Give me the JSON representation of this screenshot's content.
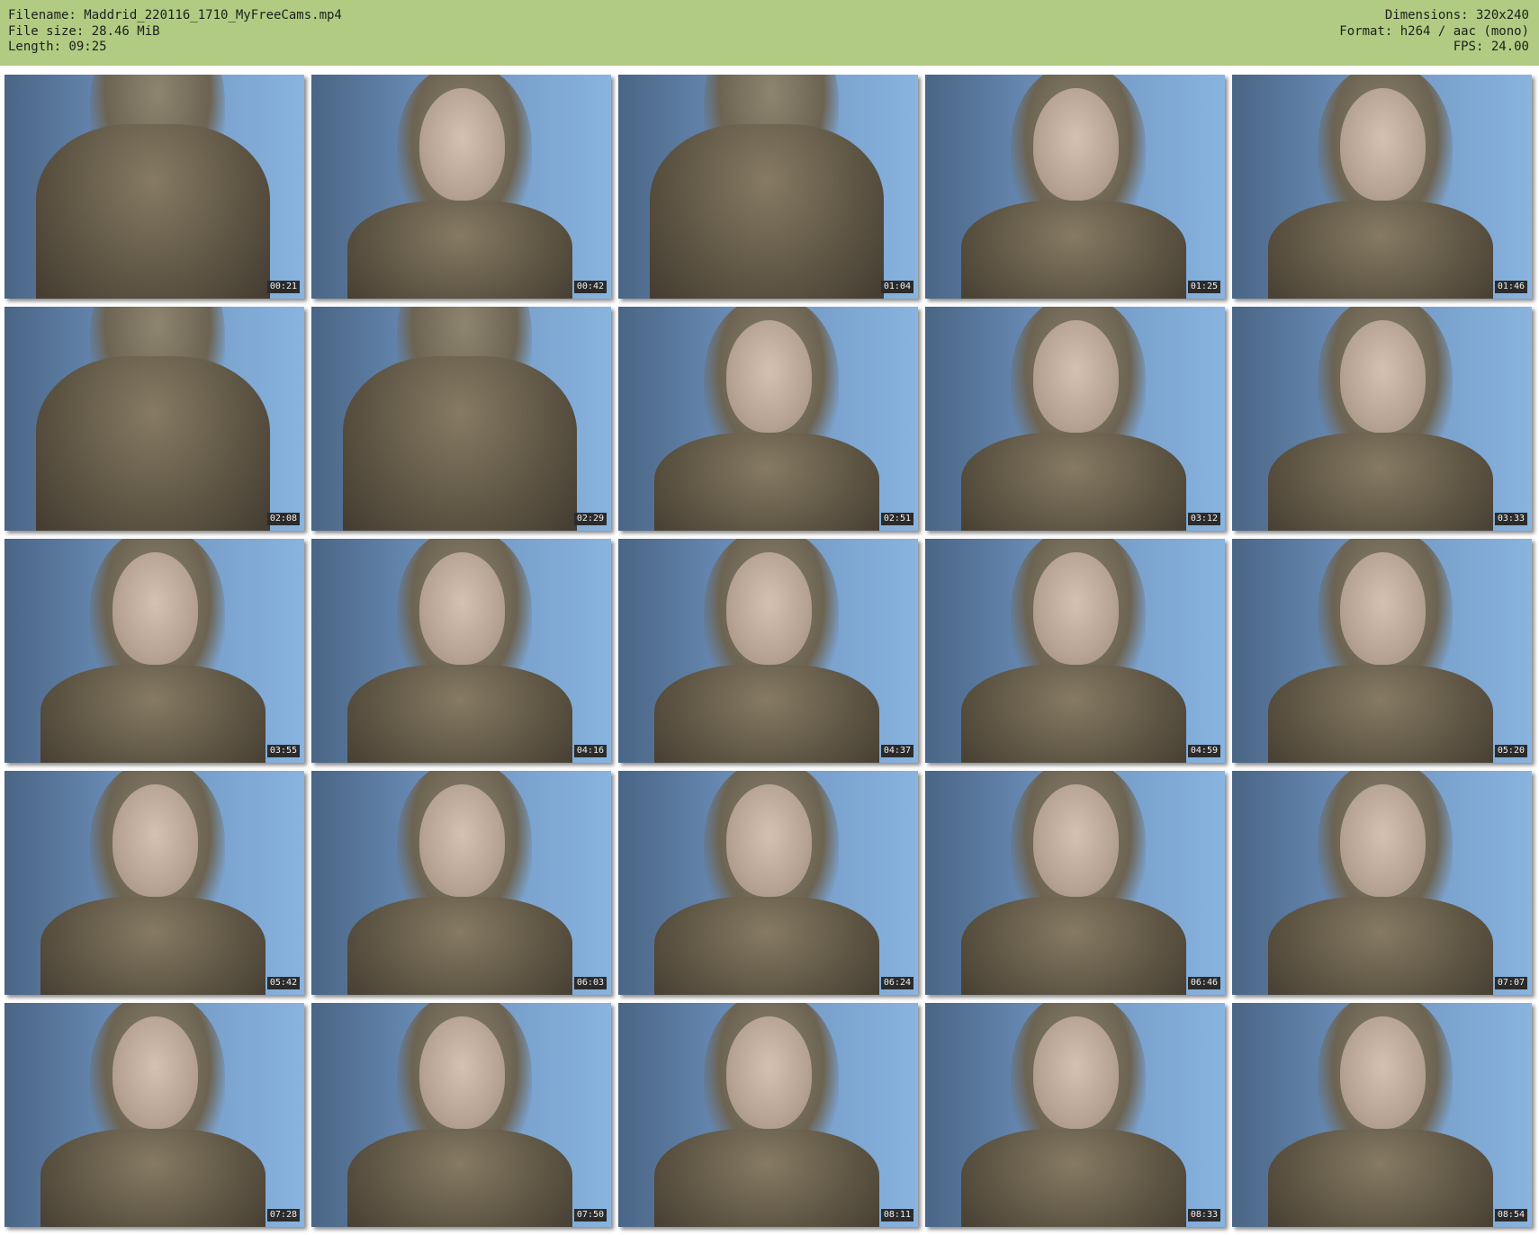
{
  "header": {
    "filename_line": "Filename: Maddrid_220116_1710_MyFreeCams.mp4",
    "filesize_line": "File size: 28.46 MiB",
    "length_line": "Length: 09:25",
    "dimensions_line": "Dimensions: 320x240",
    "format_line": "Format: h264 / aac (mono)",
    "fps_line": "FPS: 24.00"
  },
  "colors": {
    "header_bg": "#b1cc82",
    "timestamp_bg": "#2b2b2b",
    "timestamp_text": "#f0f0f0"
  },
  "thumbnails": [
    {
      "time": "00:21",
      "closeup": true
    },
    {
      "time": "00:42",
      "closeup": false
    },
    {
      "time": "01:04",
      "closeup": true
    },
    {
      "time": "01:25",
      "closeup": false
    },
    {
      "time": "01:46",
      "closeup": false
    },
    {
      "time": "02:08",
      "closeup": true
    },
    {
      "time": "02:29",
      "closeup": true
    },
    {
      "time": "02:51",
      "closeup": false
    },
    {
      "time": "03:12",
      "closeup": false
    },
    {
      "time": "03:33",
      "closeup": false
    },
    {
      "time": "03:55",
      "closeup": false
    },
    {
      "time": "04:16",
      "closeup": false
    },
    {
      "time": "04:37",
      "closeup": false
    },
    {
      "time": "04:59",
      "closeup": false
    },
    {
      "time": "05:20",
      "closeup": false
    },
    {
      "time": "05:42",
      "closeup": false
    },
    {
      "time": "06:03",
      "closeup": false
    },
    {
      "time": "06:24",
      "closeup": false
    },
    {
      "time": "06:46",
      "closeup": false
    },
    {
      "time": "07:07",
      "closeup": false
    },
    {
      "time": "07:28",
      "closeup": false
    },
    {
      "time": "07:50",
      "closeup": false
    },
    {
      "time": "08:11",
      "closeup": false
    },
    {
      "time": "08:33",
      "closeup": false
    },
    {
      "time": "08:54",
      "closeup": false
    }
  ]
}
